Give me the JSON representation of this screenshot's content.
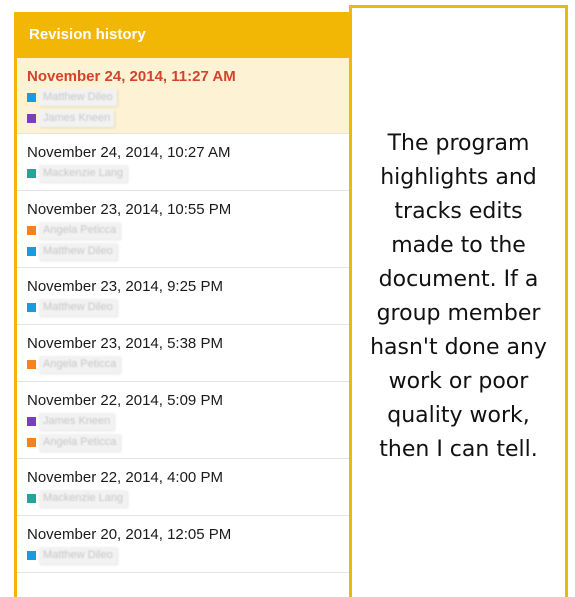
{
  "panel": {
    "title": "Revision history",
    "accent_color": "#f2b705"
  },
  "revisions": [
    {
      "timestamp": "November 24, 2014, 11:27 AM",
      "editors": [
        {
          "name": "Matthew Dileo",
          "color": "#1a9ae0"
        },
        {
          "name": "James Kneen",
          "color": "#7a3fbf"
        }
      ]
    },
    {
      "timestamp": "November 24, 2014, 10:27 AM",
      "editors": [
        {
          "name": "Mackenzie Lang",
          "color": "#22a59a"
        }
      ]
    },
    {
      "timestamp": "November 23, 2014, 10:55 PM",
      "editors": [
        {
          "name": "Angela Peticca",
          "color": "#f5821f"
        },
        {
          "name": "Matthew Dileo",
          "color": "#1a9ae0"
        }
      ]
    },
    {
      "timestamp": "November 23, 2014, 9:25 PM",
      "editors": [
        {
          "name": "Matthew Dileo",
          "color": "#1a9ae0"
        }
      ]
    },
    {
      "timestamp": "November 23, 2014, 5:38 PM",
      "editors": [
        {
          "name": "Angela Peticca",
          "color": "#f5821f"
        }
      ]
    },
    {
      "timestamp": "November 22, 2014, 5:09 PM",
      "editors": [
        {
          "name": "James Kneen",
          "color": "#7a3fbf"
        },
        {
          "name": "Angela Peticca",
          "color": "#f5821f"
        }
      ]
    },
    {
      "timestamp": "November 22, 2014, 4:00 PM",
      "editors": [
        {
          "name": "Mackenzie Lang",
          "color": "#22a59a"
        }
      ]
    },
    {
      "timestamp": "November 20, 2014, 12:05 PM",
      "editors": [
        {
          "name": "Matthew Dileo",
          "color": "#1a9ae0"
        }
      ]
    }
  ],
  "caption": {
    "text": "The program highlights and tracks edits made to the document. If a group member hasn't done any work or poor quality work, then I can tell."
  }
}
